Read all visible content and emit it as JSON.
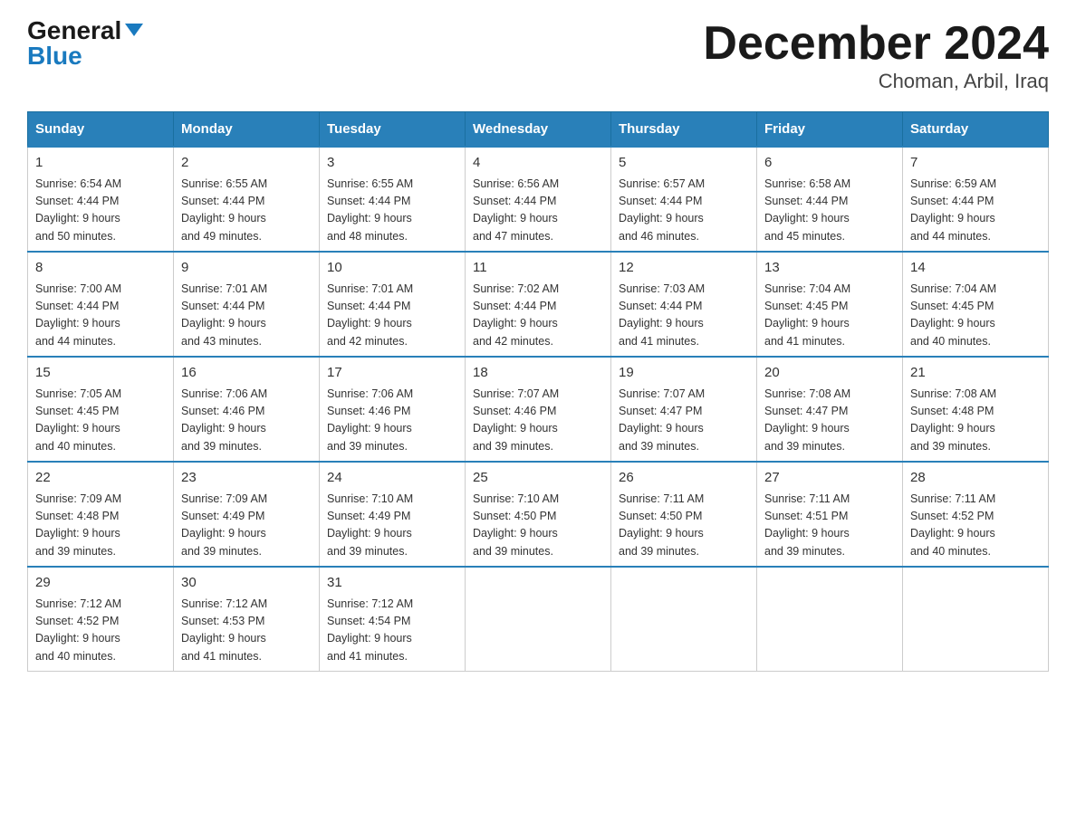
{
  "header": {
    "logo_general": "General",
    "logo_blue": "Blue",
    "title": "December 2024",
    "subtitle": "Choman, Arbil, Iraq"
  },
  "days_of_week": [
    "Sunday",
    "Monday",
    "Tuesday",
    "Wednesday",
    "Thursday",
    "Friday",
    "Saturday"
  ],
  "weeks": [
    [
      {
        "day": "1",
        "sunrise": "6:54 AM",
        "sunset": "4:44 PM",
        "daylight": "9 hours and 50 minutes."
      },
      {
        "day": "2",
        "sunrise": "6:55 AM",
        "sunset": "4:44 PM",
        "daylight": "9 hours and 49 minutes."
      },
      {
        "day": "3",
        "sunrise": "6:55 AM",
        "sunset": "4:44 PM",
        "daylight": "9 hours and 48 minutes."
      },
      {
        "day": "4",
        "sunrise": "6:56 AM",
        "sunset": "4:44 PM",
        "daylight": "9 hours and 47 minutes."
      },
      {
        "day": "5",
        "sunrise": "6:57 AM",
        "sunset": "4:44 PM",
        "daylight": "9 hours and 46 minutes."
      },
      {
        "day": "6",
        "sunrise": "6:58 AM",
        "sunset": "4:44 PM",
        "daylight": "9 hours and 45 minutes."
      },
      {
        "day": "7",
        "sunrise": "6:59 AM",
        "sunset": "4:44 PM",
        "daylight": "9 hours and 44 minutes."
      }
    ],
    [
      {
        "day": "8",
        "sunrise": "7:00 AM",
        "sunset": "4:44 PM",
        "daylight": "9 hours and 44 minutes."
      },
      {
        "day": "9",
        "sunrise": "7:01 AM",
        "sunset": "4:44 PM",
        "daylight": "9 hours and 43 minutes."
      },
      {
        "day": "10",
        "sunrise": "7:01 AM",
        "sunset": "4:44 PM",
        "daylight": "9 hours and 42 minutes."
      },
      {
        "day": "11",
        "sunrise": "7:02 AM",
        "sunset": "4:44 PM",
        "daylight": "9 hours and 42 minutes."
      },
      {
        "day": "12",
        "sunrise": "7:03 AM",
        "sunset": "4:44 PM",
        "daylight": "9 hours and 41 minutes."
      },
      {
        "day": "13",
        "sunrise": "7:04 AM",
        "sunset": "4:45 PM",
        "daylight": "9 hours and 41 minutes."
      },
      {
        "day": "14",
        "sunrise": "7:04 AM",
        "sunset": "4:45 PM",
        "daylight": "9 hours and 40 minutes."
      }
    ],
    [
      {
        "day": "15",
        "sunrise": "7:05 AM",
        "sunset": "4:45 PM",
        "daylight": "9 hours and 40 minutes."
      },
      {
        "day": "16",
        "sunrise": "7:06 AM",
        "sunset": "4:46 PM",
        "daylight": "9 hours and 39 minutes."
      },
      {
        "day": "17",
        "sunrise": "7:06 AM",
        "sunset": "4:46 PM",
        "daylight": "9 hours and 39 minutes."
      },
      {
        "day": "18",
        "sunrise": "7:07 AM",
        "sunset": "4:46 PM",
        "daylight": "9 hours and 39 minutes."
      },
      {
        "day": "19",
        "sunrise": "7:07 AM",
        "sunset": "4:47 PM",
        "daylight": "9 hours and 39 minutes."
      },
      {
        "day": "20",
        "sunrise": "7:08 AM",
        "sunset": "4:47 PM",
        "daylight": "9 hours and 39 minutes."
      },
      {
        "day": "21",
        "sunrise": "7:08 AM",
        "sunset": "4:48 PM",
        "daylight": "9 hours and 39 minutes."
      }
    ],
    [
      {
        "day": "22",
        "sunrise": "7:09 AM",
        "sunset": "4:48 PM",
        "daylight": "9 hours and 39 minutes."
      },
      {
        "day": "23",
        "sunrise": "7:09 AM",
        "sunset": "4:49 PM",
        "daylight": "9 hours and 39 minutes."
      },
      {
        "day": "24",
        "sunrise": "7:10 AM",
        "sunset": "4:49 PM",
        "daylight": "9 hours and 39 minutes."
      },
      {
        "day": "25",
        "sunrise": "7:10 AM",
        "sunset": "4:50 PM",
        "daylight": "9 hours and 39 minutes."
      },
      {
        "day": "26",
        "sunrise": "7:11 AM",
        "sunset": "4:50 PM",
        "daylight": "9 hours and 39 minutes."
      },
      {
        "day": "27",
        "sunrise": "7:11 AM",
        "sunset": "4:51 PM",
        "daylight": "9 hours and 39 minutes."
      },
      {
        "day": "28",
        "sunrise": "7:11 AM",
        "sunset": "4:52 PM",
        "daylight": "9 hours and 40 minutes."
      }
    ],
    [
      {
        "day": "29",
        "sunrise": "7:12 AM",
        "sunset": "4:52 PM",
        "daylight": "9 hours and 40 minutes."
      },
      {
        "day": "30",
        "sunrise": "7:12 AM",
        "sunset": "4:53 PM",
        "daylight": "9 hours and 41 minutes."
      },
      {
        "day": "31",
        "sunrise": "7:12 AM",
        "sunset": "4:54 PM",
        "daylight": "9 hours and 41 minutes."
      },
      null,
      null,
      null,
      null
    ]
  ],
  "labels": {
    "sunrise": "Sunrise:",
    "sunset": "Sunset:",
    "daylight": "Daylight:"
  }
}
